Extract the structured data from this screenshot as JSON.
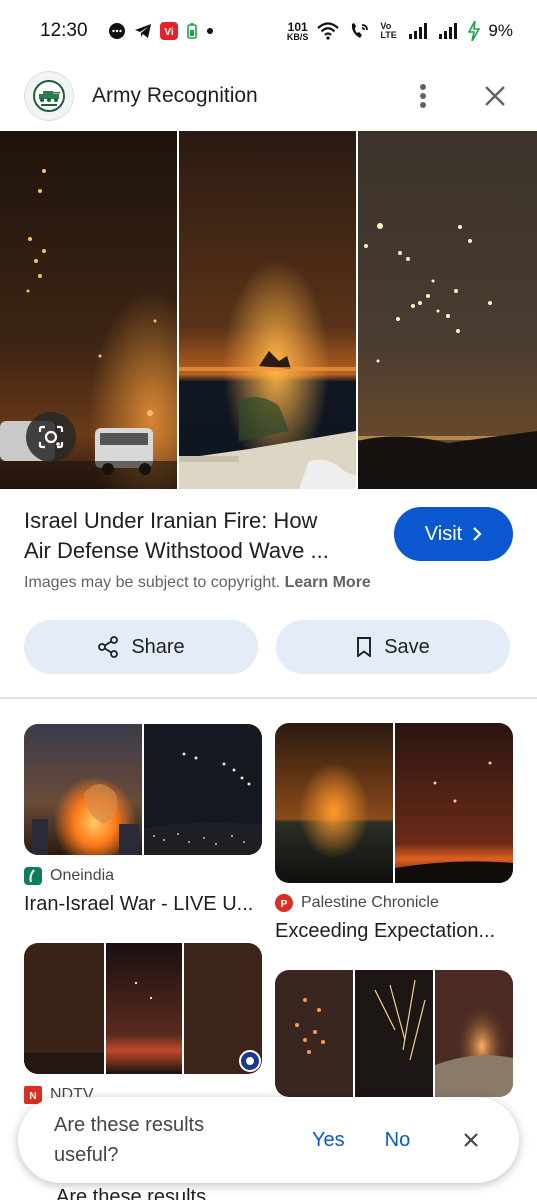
{
  "status": {
    "time": "12:30",
    "net_speed_value": "101",
    "net_speed_unit": "KB/S",
    "volte": "Vo LTE",
    "battery": "9%"
  },
  "header": {
    "site_name": "Army Recognition"
  },
  "result": {
    "title_line1": "Israel Under Iranian Fire: How",
    "title_line2": "Air Defense Withstood Wave ...",
    "visit_label": "Visit",
    "copyright_text": "Images may be subject to copyright.",
    "learn_more": "Learn More",
    "share_label": "Share",
    "save_label": "Save"
  },
  "related": [
    {
      "source": "Oneindia",
      "title": "Iran-Israel War - LIVE U...",
      "source_color": "#0f7b5f"
    },
    {
      "source": "Palestine Chronicle",
      "title": "Exceeding Expectation...",
      "source_color": "#d93025"
    },
    {
      "source": "NDTV",
      "title": "",
      "source_color": "#d93025"
    },
    {
      "source": "",
      "title": "",
      "source_color": ""
    }
  ],
  "feedback": {
    "question": "Are these results useful?",
    "yes": "Yes",
    "no": "No"
  },
  "behind_text": "Are these results"
}
